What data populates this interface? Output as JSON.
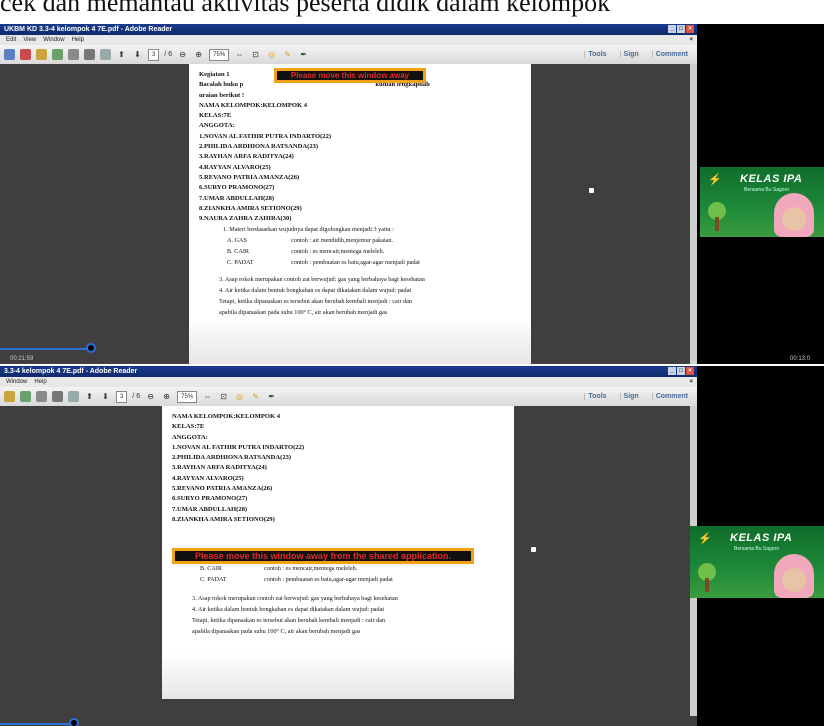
{
  "top_caption": "cek dan memantau aktivitas peserta didik dalam kelompok",
  "warning_colors": {
    "border": "#f2a017",
    "text": "#e0282c"
  },
  "screen1": {
    "title": "UKBM KD 3.3-4 kelompok 4 7E.pdf - Adobe Reader",
    "menu": [
      "Edit",
      "View",
      "Window",
      "Help"
    ],
    "page_current": "3",
    "page_total": "/ 6",
    "zoom": "75%",
    "right_tools": [
      "Tools",
      "Sign",
      "Comment"
    ],
    "warning": "Please move this window away",
    "time_left": "00:21:59",
    "time_right": "00:13:0",
    "progress": 0.11,
    "doc": {
      "heading": "Kegiatan 1",
      "intro1": "Bacalah buku p",
      "intro1b": "kudian lengkapilah",
      "intro2": "uraian berikut !",
      "lines": [
        "NAMA KELOMPOK:KELOMPOK 4",
        "KELAS:7E",
        "ANGGOTA:",
        "1.NOVAN AL FATHIR PUTRA INDARTO(22)",
        "2.PHILIDA ARDHIONA RATSANDA(23)",
        "3.RAYHAN ARFA RADITYA(24)",
        "4.RAYYAN ALVARO(25)",
        "5.REVANO PATRIA AMANZA(26)",
        "6.SURYO PRAMONO(27)",
        "7.UMAR ABDULLAH(28)",
        "8.ZIANKHA AMIRA SETIONO(29)",
        "9.NAURA ZAHRA ZAHIRA(30)"
      ],
      "q1": "1.   Materi berdasarkan wujudnya dapat digolongkan menjadi 3 yaitu :",
      "table": [
        [
          "A. GAS",
          "contoh : air mendidih,menjemur pakaian."
        ],
        [
          "B. CAIR",
          "contoh : es mencair,mentega meleleh."
        ],
        [
          "C. PADAT",
          "contoh : pembuatan es batu,agar-agar menjadi padat"
        ]
      ],
      "q2": "3.  Asap rokok merupakan contoh zat berwujud: gas yang berbahaya bagi kesehatan",
      "q3": "4.  Air ketika dalam bentuk bongkahan es  dapat dikatakan dalam wujud: padat",
      "q4": "Tetapi, ketika dipanaskan es tersebut akan berubah kembali menjadi : cair dan",
      "q5": "apabila dipanaskan pada  suhu 100° C, air akan berubah menjadi gas"
    },
    "cam": {
      "title": "KELAS IPA",
      "subtitle": "Bersama Bu Sagoro"
    }
  },
  "screen2": {
    "title": "3.3-4 kelompok 4 7E.pdf - Adobe Reader",
    "menu": [
      "Window",
      "Help"
    ],
    "page_current": "3",
    "page_total": "/ 6",
    "zoom": "75%",
    "right_tools": [
      "Tools",
      "Sign",
      "Comment"
    ],
    "warning": "Please move this window away from the shared application.",
    "progress": 0.09,
    "doc": {
      "lines": [
        "NAMA KELOMPOK:KELOMPOK 4",
        "KELAS:7E",
        "ANGGOTA:",
        "1.NOVAN AL FATHIR PUTRA INDARTO(22)",
        "2.PHILIDA ARDHIONA RATSANDA(23)",
        "3.RAYHAN ARFA RADITYA(24)",
        "4.RAYYAN ALVARO(25)",
        "5.REVANO PATRIA AMANZA(26)",
        "6.SURYO PRAMONO(27)",
        "7.UMAR ABDULLAH(28)",
        "8.ZIANKHA AMIRA SETIONO(29)"
      ],
      "table": [
        [
          "B. CAIR",
          "contoh : es mencair,mentega meleleh."
        ],
        [
          "C. PADAT",
          "contoh : pembuatan es batu,agar-agar menjadi padat"
        ]
      ],
      "q2": "3.  Asap rokok merupakan contoh zat berwujud: gas yang berbahaya bagi kesehatan",
      "q3": "4.  Air ketika dalam bentuk bongkahan es  dapat dikatakan dalam wujud: padat",
      "q4": "Tetapi, ketika dipanaskan es tersebut akan berubah kembali menjadi : cair dan",
      "q5": "apabila dipanaskan pada  suhu 100° C, air akan berubah menjadi gas"
    },
    "cam": {
      "title": "KELAS IPA",
      "subtitle": "Bersama Bu Sagoro"
    }
  }
}
